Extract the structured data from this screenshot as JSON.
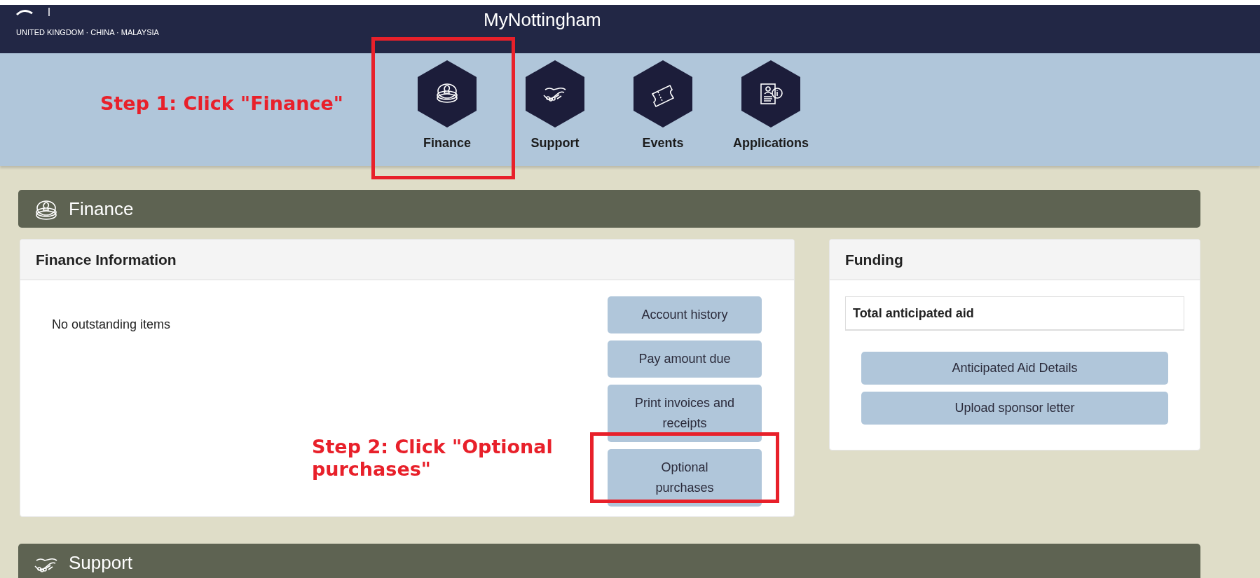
{
  "header": {
    "title": "MyNottingham",
    "tagline": "UNITED KINGDOM · CHINA · MALAYSIA"
  },
  "nav": [
    {
      "label": "Finance",
      "kind": "coins"
    },
    {
      "label": "Support",
      "kind": "handshake"
    },
    {
      "label": "Events",
      "kind": "ticket"
    },
    {
      "label": "Applications",
      "kind": "document"
    }
  ],
  "annotations": [
    {
      "text": "Step 1: Click \"Finance\""
    },
    {
      "text": "Step 2: Click \"Optional purchases\""
    }
  ],
  "finance_section": {
    "title": "Finance",
    "kind": "coins"
  },
  "finance_information": {
    "title": "Finance Information",
    "message": "No outstanding items",
    "buttons": [
      "Account history",
      "Pay amount due",
      "Print invoices and receipts",
      "Optional purchases"
    ]
  },
  "funding": {
    "title": "Funding",
    "total_label": "Total anticipated aid",
    "buttons": [
      "Anticipated Aid Details",
      "Upload sponsor letter"
    ]
  },
  "support_section": {
    "title": "Support",
    "kind": "handshake"
  }
}
